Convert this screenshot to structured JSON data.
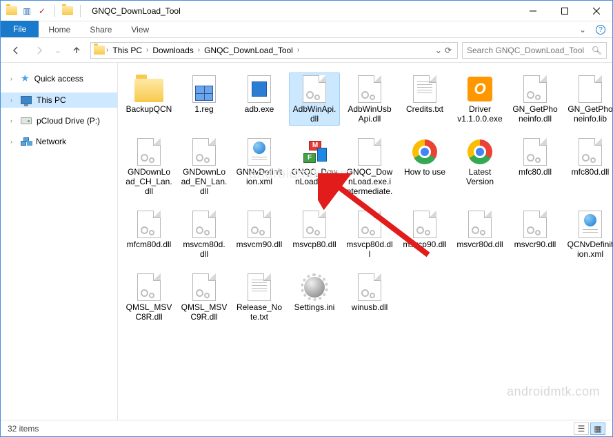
{
  "titlebar": {
    "title": "GNQC_DownLoad_Tool"
  },
  "tabs": {
    "file": "File",
    "home": "Home",
    "share": "Share",
    "view": "View"
  },
  "breadcrumb": {
    "seg1": "This PC",
    "seg2": "Downloads",
    "seg3": "GNQC_DownLoad_Tool"
  },
  "search": {
    "placeholder": "Search GNQC_DownLoad_Tool"
  },
  "sidebar": {
    "quick": "Quick access",
    "thispc": "This PC",
    "pcloud": "pCloud Drive (P:)",
    "network": "Network"
  },
  "files": [
    {
      "name": "BackupQCN",
      "type": "folder"
    },
    {
      "name": "1.reg",
      "type": "reg"
    },
    {
      "name": "adb.exe",
      "type": "exe"
    },
    {
      "name": "AdbWinApi.dll",
      "type": "dll",
      "selected": true
    },
    {
      "name": "AdbWinUsbApi.dll",
      "type": "dll"
    },
    {
      "name": "Credits.txt",
      "type": "txt"
    },
    {
      "name": "Driver v1.1.0.0.exe",
      "type": "driver"
    },
    {
      "name": "GN_GetPhoneinfo.dll",
      "type": "dll"
    },
    {
      "name": "GN_GetPhoneinfo.lib",
      "type": "page"
    },
    {
      "name": "GNDownLoad_CH_Lan.dll",
      "type": "dll"
    },
    {
      "name": "GNDownLoad_EN_Lan.dll",
      "type": "dll"
    },
    {
      "name": "GNNvDefinition.xml",
      "type": "xml"
    },
    {
      "name": "GNQC_DownLoad.exe",
      "type": "gnqc"
    },
    {
      "name": "GNQC_DownLoad.exe.intermediate.manif...",
      "type": "page"
    },
    {
      "name": "How to use",
      "type": "chrome"
    },
    {
      "name": "Latest Version",
      "type": "chrome"
    },
    {
      "name": "mfc80.dll",
      "type": "dll"
    },
    {
      "name": "mfc80d.dll",
      "type": "dll"
    },
    {
      "name": "mfcm80d.dll",
      "type": "dll"
    },
    {
      "name": "msvcm80d.dll",
      "type": "dll"
    },
    {
      "name": "msvcm90.dll",
      "type": "dll"
    },
    {
      "name": "msvcp80.dll",
      "type": "dll"
    },
    {
      "name": "msvcp80d.dll",
      "type": "dll"
    },
    {
      "name": "msvcp90.dll",
      "type": "dll"
    },
    {
      "name": "msvcr80d.dll",
      "type": "dll"
    },
    {
      "name": "msvcr90.dll",
      "type": "dll"
    },
    {
      "name": "QCNvDefinition.xml",
      "type": "xml"
    },
    {
      "name": "QMSL_MSVC8R.dll",
      "type": "dll"
    },
    {
      "name": "QMSL_MSVC9R.dll",
      "type": "dll"
    },
    {
      "name": "Release_Note.txt",
      "type": "txt"
    },
    {
      "name": "Settings.ini",
      "type": "ini"
    },
    {
      "name": "winusb.dll",
      "type": "dll"
    }
  ],
  "status": {
    "count": "32 items"
  },
  "watermark": "androidmtk.com"
}
